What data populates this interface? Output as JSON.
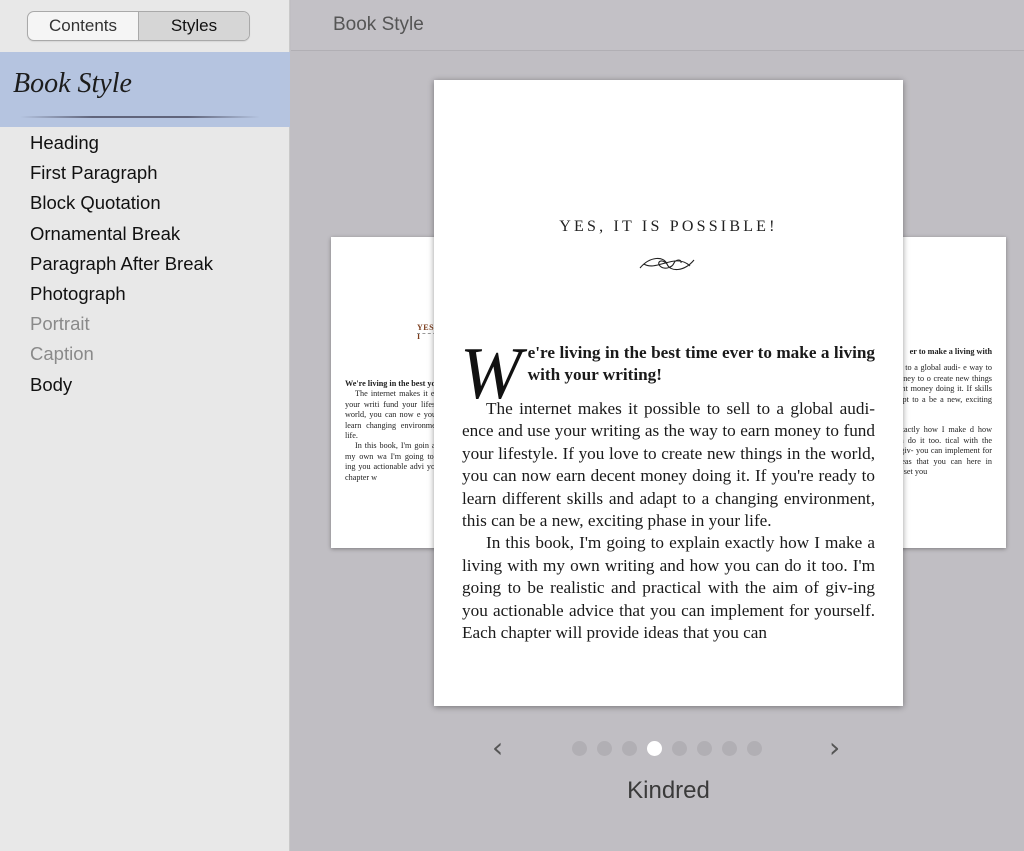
{
  "sidebar": {
    "tabs": [
      {
        "label": "Contents",
        "active": false
      },
      {
        "label": "Styles",
        "active": true
      }
    ],
    "heading": "Book Style",
    "items": [
      {
        "label": "Heading",
        "dimmed": false
      },
      {
        "label": "First Paragraph",
        "dimmed": false
      },
      {
        "label": "Block Quotation",
        "dimmed": false
      },
      {
        "label": "Ornamental Break",
        "dimmed": false
      },
      {
        "label": "Paragraph After Break",
        "dimmed": false
      },
      {
        "label": "Photograph",
        "dimmed": false
      },
      {
        "label": "Portrait",
        "dimmed": true
      },
      {
        "label": "Caption",
        "dimmed": true
      },
      {
        "label": "Body",
        "dimmed": false
      }
    ]
  },
  "header": {
    "title": "Book Style"
  },
  "preview": {
    "chapter_title": "YES, IT IS POSSIBLE!",
    "drop_cap": "W",
    "lead": "e're living in the best time ever to make a living with your writing!",
    "paragraphs": [
      "The internet makes it possible to sell to a global audi-ence and use your writing as the way to earn money to fund your lifestyle. If you love to create new things in the world, you can now earn decent money doing it. If you're ready to learn different skills and adapt to a changing environment, this can be a new, exciting phase in your life.",
      "In this book, I'm going to explain exactly how I make a living with my own writing and how you can do it too. I'm going to be realistic and practical with the aim of giv-ing you actionable advice that you can implement for yourself. Each chapter will provide ideas that you can"
    ],
    "left_thumb": {
      "head": "YES, I",
      "lead": "We're living in the best your writing!",
      "p1": "The internet makes it ence and use your writi fund your lifestyle. If you world, you can now e you're ready to learn changing environment, in your life.",
      "p2": "In this book, I'm goin a living with my own wa I'm going to be realistic ing you actionable advi yourself. Each chapter w"
    },
    "right_thumb": {
      "lead": "er to make a living with",
      "p1": "e to sell to a global audi- e way to earn money to o create new things in the ent money doing it. If skills and adapt to a be a new, exciting phase",
      "p2": "plain exactly how I make d how you can do it too. tical with the aim of giv- you can implement for vide ideas that you can here in order to set you"
    }
  },
  "pager": {
    "prev_icon": "chevron-left-icon",
    "next_icon": "chevron-right-icon",
    "page_count": 8,
    "active_index": 3,
    "theme_name": "Kindred"
  }
}
